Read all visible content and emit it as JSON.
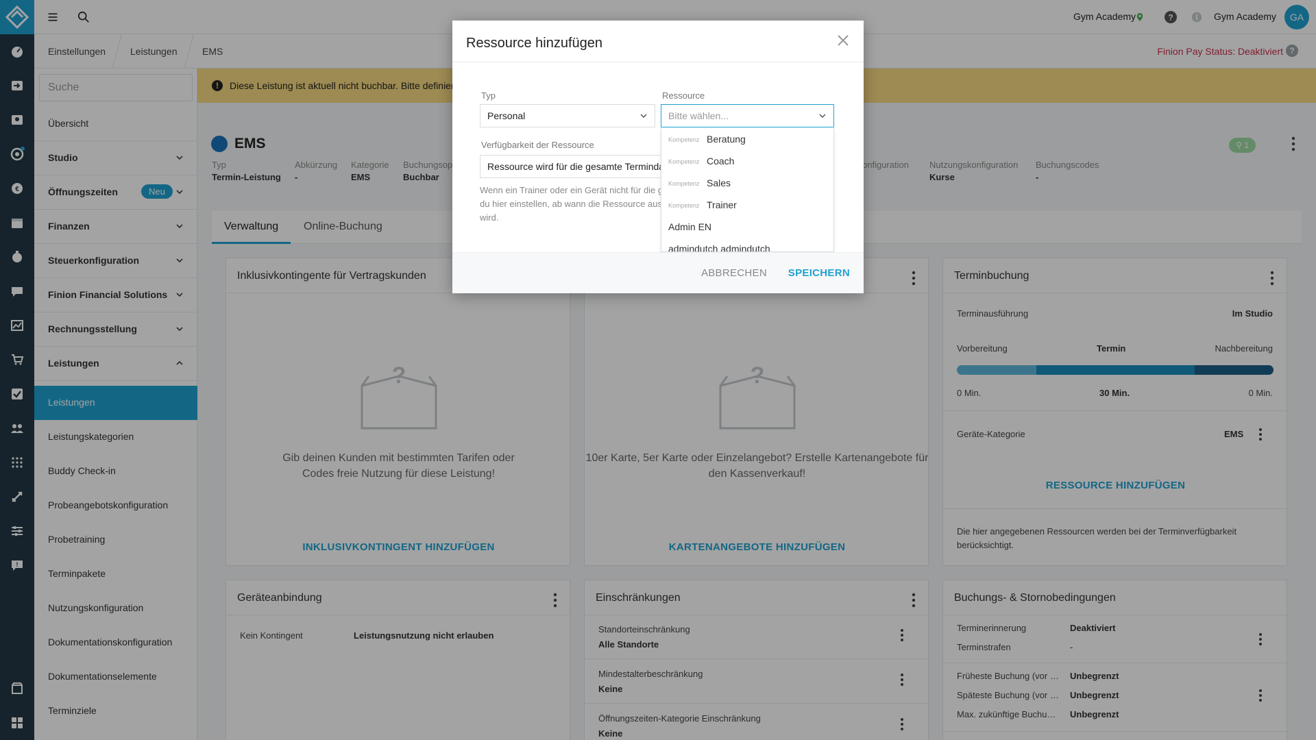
{
  "topbar": {
    "studio_name": "Gym Academy",
    "account_name": "Gym Academy",
    "avatar_initials": "GA"
  },
  "breadcrumb": [
    "Einstellungen",
    "Leistungen",
    "EMS"
  ],
  "pay_status": "Finion Pay Status: Deaktiviert",
  "pay_help": "?",
  "sidebar": {
    "search_placeholder": "Suche",
    "items": [
      {
        "label": "Übersicht"
      },
      {
        "label": "Studio"
      },
      {
        "label": "Öffnungszeiten",
        "badge": "Neu"
      },
      {
        "label": "Finanzen"
      },
      {
        "label": "Steuerkonfiguration"
      },
      {
        "label": "Finion Financial Solutions"
      },
      {
        "label": "Rechnungsstellung"
      },
      {
        "label": "Leistungen"
      },
      {
        "label": "Leistungen"
      },
      {
        "label": "Leistungskategorien"
      },
      {
        "label": "Buddy Check-in"
      },
      {
        "label": "Probeangebotskonfiguration"
      },
      {
        "label": "Probetraining"
      },
      {
        "label": "Terminpakete"
      },
      {
        "label": "Nutzungskonfiguration"
      },
      {
        "label": "Dokumentationskonfiguration"
      },
      {
        "label": "Dokumentationselemente"
      },
      {
        "label": "Terminziele"
      }
    ]
  },
  "warning": {
    "icon": "exclamation-icon",
    "text": "Diese Leistung ist aktuell nicht buchbar. Bitte definiere m"
  },
  "service": {
    "name": "EMS",
    "color": "#1a72bb",
    "location_badge": "1",
    "meta": [
      {
        "key": "Typ",
        "value": "Termin-Leistung"
      },
      {
        "key": "Abkürzung",
        "value": "-"
      },
      {
        "key": "Kategorie",
        "value": "EMS"
      },
      {
        "key": "Buchungsop",
        "value": "Buchbar"
      },
      {
        "key": "onfiguration",
        "value": ""
      },
      {
        "key": "Nutzungskonfiguration",
        "value": "Kurse"
      },
      {
        "key": "Buchungscodes",
        "value": "-"
      }
    ]
  },
  "tabs": [
    {
      "label": "Verwaltung",
      "active": true
    },
    {
      "label": "Online-Buchung",
      "active": false
    }
  ],
  "cards": {
    "inklusiv": {
      "title": "Inklusivkontingente für Vertragskunden",
      "empty_text": "Gib deinen Kunden mit bestimmten Tarifen oder Codes freie Nutzung für diese Leistung!",
      "link": "INKLUSIVKONTINGENT HINZUFÜGEN"
    },
    "karten": {
      "empty_text": "10er Karte, 5er Karte oder Einzelangebot? Erstelle Kartenangebote für den Kassenverkauf!",
      "link": "KARTENANGEBOTE HINZUFÜGEN"
    },
    "terminbuchung": {
      "title": "Terminbuchung",
      "ausfuehrung_label": "Terminausführung",
      "ausfuehrung_value": "Im Studio",
      "vorbereitung": "Vorbereitung",
      "termin": "Termin",
      "nachbereitung": "Nachbereitung",
      "vor_min": "0 Min.",
      "termin_min": "30 Min.",
      "nach_min": "0 Min.",
      "geraete_label": "Geräte-Kategorie",
      "geraete_value": "EMS",
      "link": "RESSOURCE HINZUFÜGEN",
      "note": "Die hier angegebenen Ressourcen werden bei der Terminverfügbarkeit berücksichtigt."
    },
    "geraete": {
      "title": "Geräteanbindung",
      "row_key": "Kein Kontingent",
      "row_value": "Leistungsnutzung nicht erlauben"
    },
    "einschraenkungen": {
      "title": "Einschränkungen",
      "rows": [
        {
          "key": "Standorteinschränkung",
          "value": "Alle Standorte"
        },
        {
          "key": "Mindestalterbeschränkung",
          "value": "Keine"
        },
        {
          "key": "Öffnungszeiten-Kategorie Einschränkung",
          "value": "Keine"
        }
      ]
    },
    "buchung": {
      "title": "Buchungs- & Stornobedingungen",
      "rows": [
        {
          "key": "Terminerinnerung",
          "value": "Deaktiviert"
        },
        {
          "key": "Terminstrafen",
          "value": "-"
        },
        {
          "key": "Früheste Buchung (vor …",
          "value": "Unbegrenzt"
        },
        {
          "key": "Späteste Buchung (vor …",
          "value": "Unbegrenzt"
        },
        {
          "key": "Max. zukünftige Buchu…",
          "value": "Unbegrenzt"
        }
      ]
    }
  },
  "modal": {
    "title": "Ressource hinzufügen",
    "type_label": "Typ",
    "type_value": "Personal",
    "resource_label": "Ressource",
    "resource_placeholder": "Bitte wählen...",
    "availability_label": "Verfügbarkeit der Ressource",
    "availability_value": "Ressource wird für die gesamte Termindaue",
    "help_text": "Wenn ein Trainer oder ein Gerät nicht für die g du hier einstellen, ab wann die Ressource aus wird.",
    "cancel": "ABBRECHEN",
    "save": "SPEICHERN",
    "options": [
      {
        "tag": "Kompetenz",
        "name": "Beratung"
      },
      {
        "tag": "Kompetenz",
        "name": "Coach"
      },
      {
        "tag": "Kompetenz",
        "name": "Sales"
      },
      {
        "tag": "Kompetenz",
        "name": "Trainer"
      },
      {
        "tag": "",
        "name": "Admin EN"
      },
      {
        "tag": "",
        "name": "admindutch admindutch"
      }
    ]
  },
  "colors": {
    "accent": "#1fa1d1",
    "rail": "#233845",
    "warning_bg": "#f6d982",
    "status_red": "#c9314b"
  }
}
